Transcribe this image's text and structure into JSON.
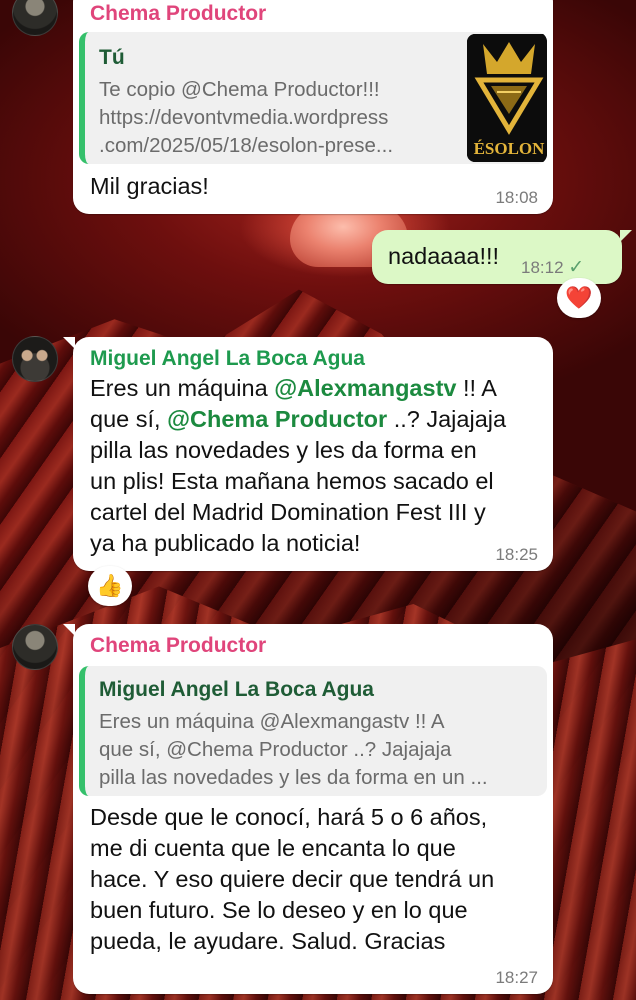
{
  "colors": {
    "sender_pink": "#e0457b",
    "sender_green": "#1e9a4e",
    "outgoing_bubble": "#dcf8c6",
    "quote_bar": "#35c06b",
    "wallpaper_red": "#6e0f0e"
  },
  "messages": [
    {
      "sender": "Chema Productor",
      "quote": {
        "sender": "Tú",
        "lines": [
          "Te copio @Chema Productor!!!",
          "https://devontvmedia.wordpress",
          ".com/2025/05/18/esolon-prese..."
        ],
        "thumbnail_text": "ÉSOLON"
      },
      "text": "Mil gracias!",
      "time": "18:08"
    },
    {
      "direction": "outgoing",
      "text": "nadaaaa!!!",
      "time": "18:12",
      "status_icon": "single-check-icon",
      "reaction": "❤️"
    },
    {
      "sender": "Miguel Angel La Boca Agua",
      "lines": [
        [
          "Eres un máquina ",
          "@Alexmangastv",
          " !! A"
        ],
        [
          "que sí, ",
          "@Chema Productor",
          " ..? Jajajaja"
        ],
        [
          "pilla las novedades y les da forma en",
          "",
          ""
        ],
        [
          "un plis! Esta mañana hemos sacado el",
          "",
          ""
        ],
        [
          "cartel del Madrid Domination Fest III y",
          "",
          ""
        ],
        [
          "ya ha publicado la noticia!",
          "",
          ""
        ]
      ],
      "time": "18:25",
      "reaction": "👍"
    },
    {
      "sender": "Chema Productor",
      "quote": {
        "sender": "Miguel Angel La Boca Agua",
        "lines": [
          "Eres un máquina @Alexmangastv !! A",
          "que sí, @Chema Productor ..? Jajajaja",
          "pilla las novedades y les da forma en un ..."
        ]
      },
      "lines": [
        "Desde que le conocí, hará 5 o 6 años,",
        "me di cuenta que le encanta lo que",
        "hace. Y eso quiere decir que tendrá un",
        "buen futuro. Se lo deseo y en lo que",
        "pueda, le ayudare. Salud. Gracias"
      ],
      "time": "18:27"
    }
  ]
}
